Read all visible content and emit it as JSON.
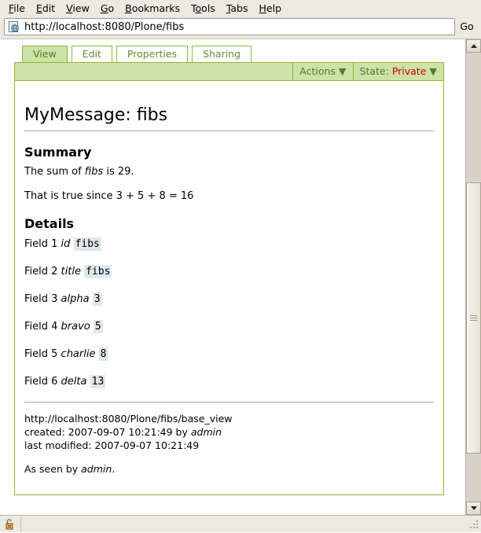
{
  "browser": {
    "menu": [
      {
        "label": "File",
        "accel": "F"
      },
      {
        "label": "Edit",
        "accel": "E"
      },
      {
        "label": "View",
        "accel": "V"
      },
      {
        "label": "Go",
        "accel": "G"
      },
      {
        "label": "Bookmarks",
        "accel": "B"
      },
      {
        "label": "Tools",
        "accel": "o"
      },
      {
        "label": "Tabs",
        "accel": "T"
      },
      {
        "label": "Help",
        "accel": "H"
      }
    ],
    "url": "http://localhost:8080/Plone/fibs",
    "url_placeholder": "Enter web address",
    "go_label": "Go",
    "url_icon": "page-globe-icon",
    "status_icon": "open-padlock-icon",
    "status_text": ""
  },
  "plone": {
    "tabs": [
      {
        "label": "View",
        "active": true
      },
      {
        "label": "Edit",
        "active": false
      },
      {
        "label": "Properties",
        "active": false
      },
      {
        "label": "Sharing",
        "active": false
      }
    ],
    "actions_label": "Actions ▼",
    "state_prefix": "State: ",
    "state_value": "Private",
    "state_caret": " ▼",
    "title": "MyMessage: fibs",
    "summary_heading": "Summary",
    "summary_line1_pre": "The sum of ",
    "summary_line1_em": "fibs",
    "summary_line1_post": " is 29.",
    "summary_line2": "That is true since 3 + 5 + 8 = 16",
    "details_heading": "Details",
    "fields": [
      {
        "label": "Field 1 ",
        "name": "id",
        "value": "fibs"
      },
      {
        "label": "Field 2 ",
        "name": "title",
        "value": "fibs"
      },
      {
        "label": "Field 3 ",
        "name": "alpha",
        "value": "3"
      },
      {
        "label": "Field 4 ",
        "name": "bravo",
        "value": "5"
      },
      {
        "label": "Field 5 ",
        "name": "charlie",
        "value": "8"
      },
      {
        "label": "Field 6 ",
        "name": "delta",
        "value": "13"
      }
    ],
    "meta_url": "http://localhost:8080/Plone/fibs/base_view",
    "meta_created_pre": "created: 2007-09-07 10:21:49 by ",
    "meta_created_user": "admin",
    "meta_modified": "last modified: 2007-09-07 10:21:49",
    "seen_pre": "As seen by ",
    "seen_user": "admin",
    "seen_post": "."
  },
  "colors": {
    "plone_green_border": "#8cb83a",
    "plone_green_fill": "#cde2a7",
    "state_red": "#cc0000",
    "rule_blue": "#8cacbb",
    "value_bg": "#dee7ec",
    "chrome_bg": "#ece9e0"
  }
}
